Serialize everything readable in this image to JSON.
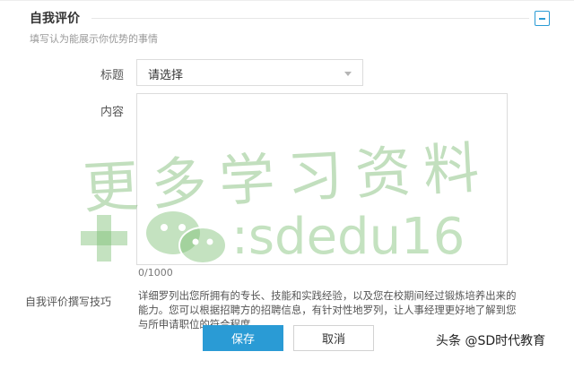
{
  "section": {
    "title": "自我评价",
    "subtitle": "填写认为能展示你优势的事情",
    "collapse_icon": "minus-icon"
  },
  "form": {
    "title_label": "标题",
    "title_select_value": "请选择",
    "content_label": "内容",
    "content_value": "",
    "char_count": "0/1000"
  },
  "tips": {
    "label": "自我评价撰写技巧",
    "text": "详细罗列出您所拥有的专长、技能和实践经验，以及您在校期间经过锻炼培养出来的能力。您可以根据招聘方的招聘信息，有针对性地罗列，让人事经理更好地了解到您与所申请职位的符合程度。"
  },
  "buttons": {
    "save": "保存",
    "cancel": "取消"
  },
  "watermark": {
    "line1": "更多学习资料",
    "line2": ":sdedu16",
    "color": "#7cbd6e"
  },
  "credit": "头条 @SD时代教育",
  "colors": {
    "accent": "#2a9bd5",
    "border": "#dcdcdc"
  }
}
